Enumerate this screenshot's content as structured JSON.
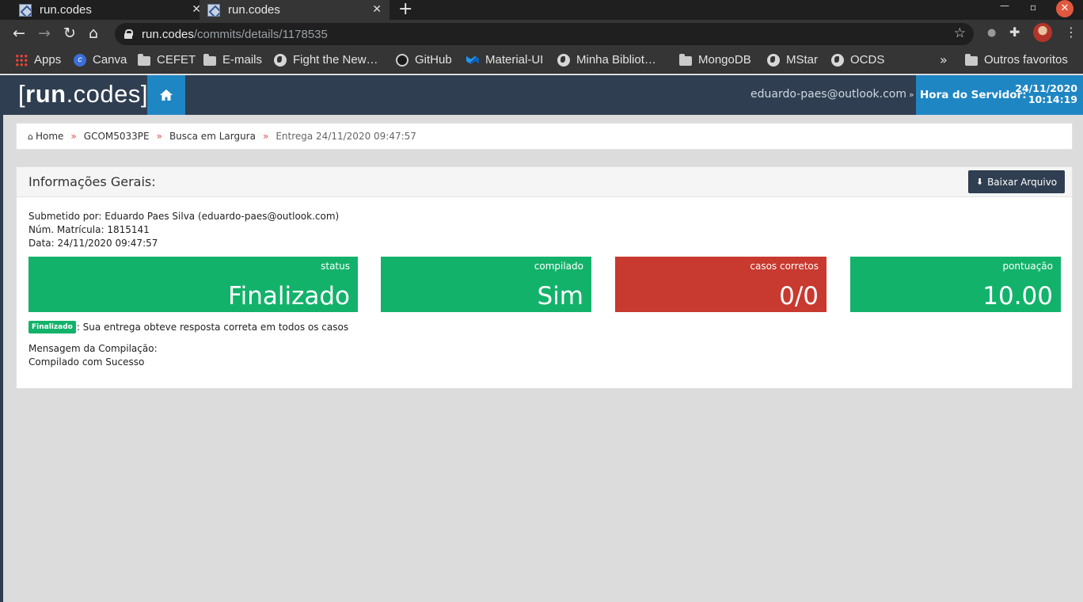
{
  "browser": {
    "tabs": [
      {
        "title": "run.codes"
      },
      {
        "title": "run.codes"
      }
    ],
    "new_tab": "+",
    "url_host": "run.codes",
    "url_path": "/commits/details/1178535",
    "bookmarks": [
      {
        "label": "Apps",
        "icon": "apps-icon"
      },
      {
        "label": "Canva",
        "icon": "canva-icon"
      },
      {
        "label": "CEFET",
        "icon": "folder-icon"
      },
      {
        "label": "E-mails",
        "icon": "folder-icon"
      },
      {
        "label": "Fight the New…",
        "icon": "globe-icon"
      },
      {
        "label": "GitHub",
        "icon": "github-icon"
      },
      {
        "label": "Material-UI",
        "icon": "material-ui-icon"
      },
      {
        "label": "Minha Bibliot…",
        "icon": "globe-icon"
      },
      {
        "label": "MongoDB",
        "icon": "folder-icon"
      },
      {
        "label": "MStar",
        "icon": "globe-icon"
      },
      {
        "label": "OCDS",
        "icon": "globe-icon"
      },
      {
        "label": "Outros favoritos",
        "icon": "folder-icon"
      }
    ],
    "more": "»"
  },
  "header": {
    "logo_open": "[",
    "logo_bold": "run",
    "logo_rest": ".codes]",
    "user": "eduardo-paes@outlook.com",
    "server_label": "Hora do Servidor:",
    "server_date": "24/11/2020",
    "server_time": "10:14:19"
  },
  "breadcrumb": {
    "home": "Home",
    "course": "GCOM5033PE",
    "exercise": "Busca em Largura",
    "current": "Entrega 24/11/2020 09:47:57"
  },
  "panel": {
    "title": "Informações Gerais:",
    "download_label": "Baixar Arquivo",
    "submitted_by": "Submetido por: Eduardo Paes Silva (eduardo-paes@outlook.com)",
    "registration": "Núm. Matrícula: 1815141",
    "date": "Data: 24/11/2020 09:47:57",
    "stats": [
      {
        "label": "status",
        "value": "Finalizado",
        "color": "#13b26b"
      },
      {
        "label": "compilado",
        "value": "Sim",
        "color": "#13b26b"
      },
      {
        "label": "casos corretos",
        "value": "0/0",
        "color": "#c8392f"
      },
      {
        "label": "pontuação",
        "value": "10.00",
        "color": "#13b26b"
      }
    ],
    "badge": "Finalizado",
    "result_text": ": Sua entrega obteve resposta correta em todos os casos",
    "compile_label": "Mensagem da Compilação:",
    "compile_message": "Compilado com Sucesso"
  }
}
